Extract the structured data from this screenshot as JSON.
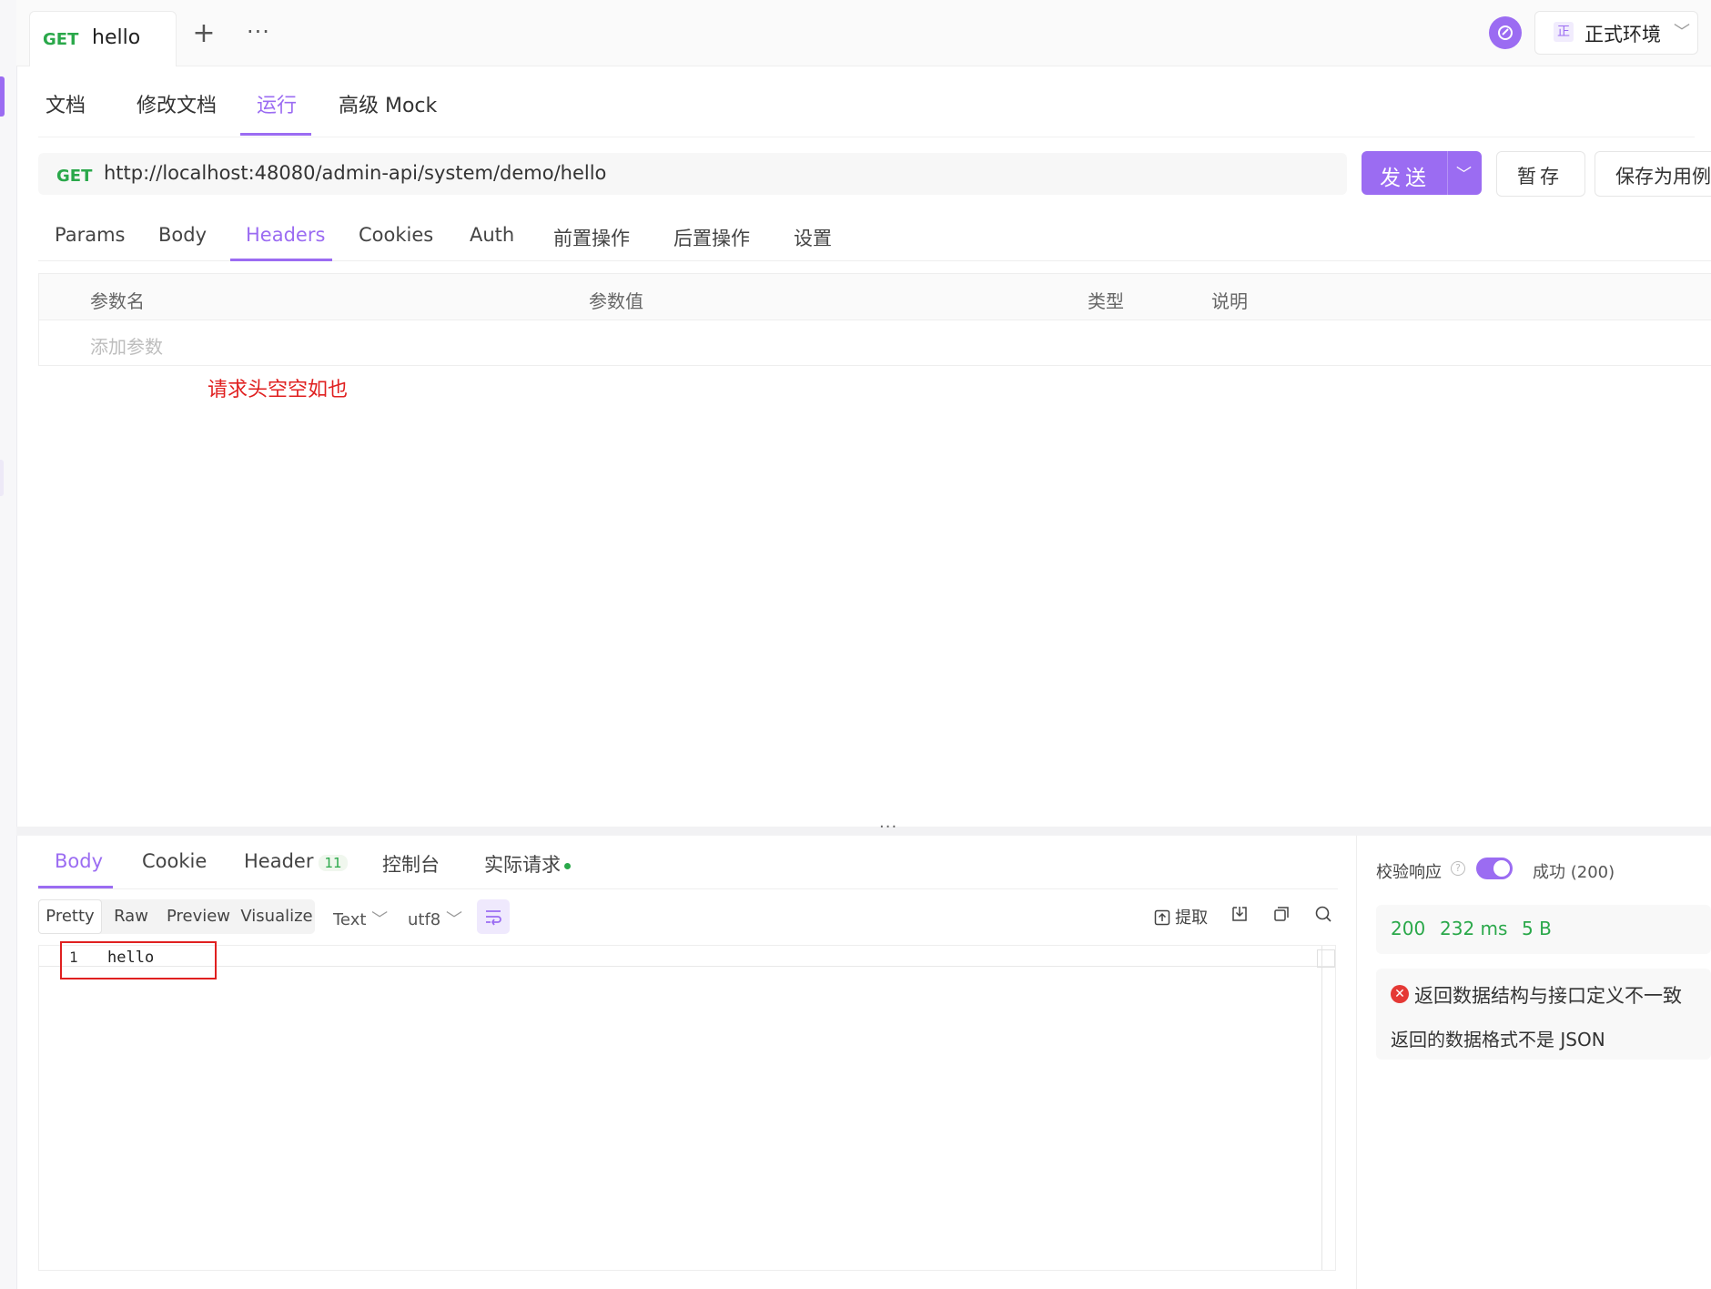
{
  "request_tab": {
    "method": "GET",
    "name": "hello"
  },
  "topbar": {
    "plus": "+",
    "more": "···"
  },
  "environment": {
    "badge": "正",
    "name": "正式环境"
  },
  "doc_tabs": [
    "文档",
    "修改文档",
    "运行",
    "高级 Mock"
  ],
  "active_doc_tab": "运行",
  "url_bar": {
    "method": "GET",
    "url": "http://localhost:48080/admin-api/system/demo/hello"
  },
  "buttons": {
    "send": "发送",
    "save": "暂存",
    "save_as": "保存为用例"
  },
  "param_tabs": [
    "Params",
    "Body",
    "Headers",
    "Cookies",
    "Auth",
    "前置操作",
    "后置操作",
    "设置"
  ],
  "active_param_tab": "Headers",
  "headers_table": {
    "columns": [
      "参数名",
      "参数值",
      "类型",
      "说明"
    ],
    "add_placeholder": "添加参数"
  },
  "annotation": "请求头空空如也",
  "response_tabs": {
    "body": "Body",
    "cookie": "Cookie",
    "header": "Header",
    "header_count": "11",
    "console": "控制台",
    "actual_request": "实际请求"
  },
  "view_modes": [
    "Pretty",
    "Raw",
    "Preview",
    "Visualize"
  ],
  "active_view_mode": "Pretty",
  "format": {
    "type": "Text",
    "encoding": "utf8"
  },
  "tools": {
    "extract": "提取"
  },
  "editor": {
    "line_number": "1",
    "content": "hello"
  },
  "validation": {
    "label": "校验响应",
    "status": "成功 (200)",
    "enabled": true
  },
  "stats": {
    "status_code": "200",
    "time": "232 ms",
    "size": "5 B"
  },
  "error": {
    "title": "返回数据结构与接口定义不一致",
    "description": "返回的数据格式不是 JSON"
  },
  "colors": {
    "accent": "#9b6cf2",
    "success": "#2aa84a",
    "error": "#e02020"
  }
}
